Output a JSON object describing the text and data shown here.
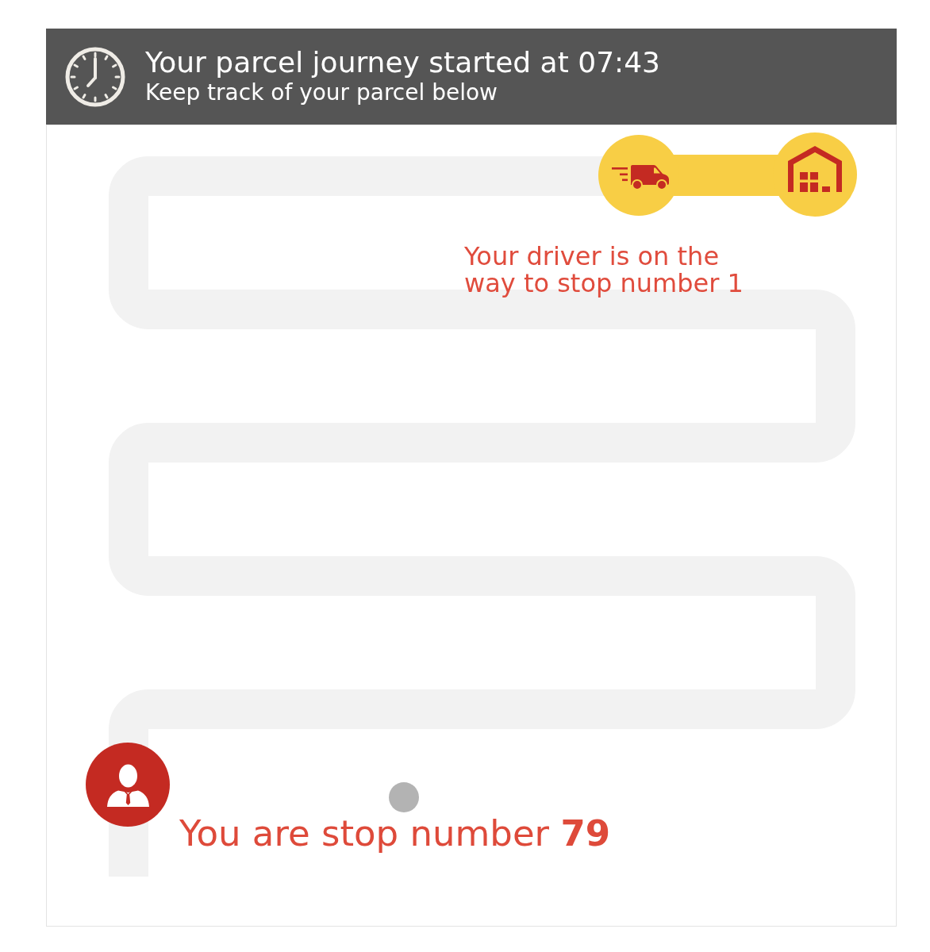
{
  "header": {
    "title": "Your parcel journey started at 07:43",
    "subtitle": "Keep track of your parcel below"
  },
  "route": {
    "driver_message": "Your driver is on the way to stop number 1",
    "stop_message": "You are stop number **79**"
  }
}
